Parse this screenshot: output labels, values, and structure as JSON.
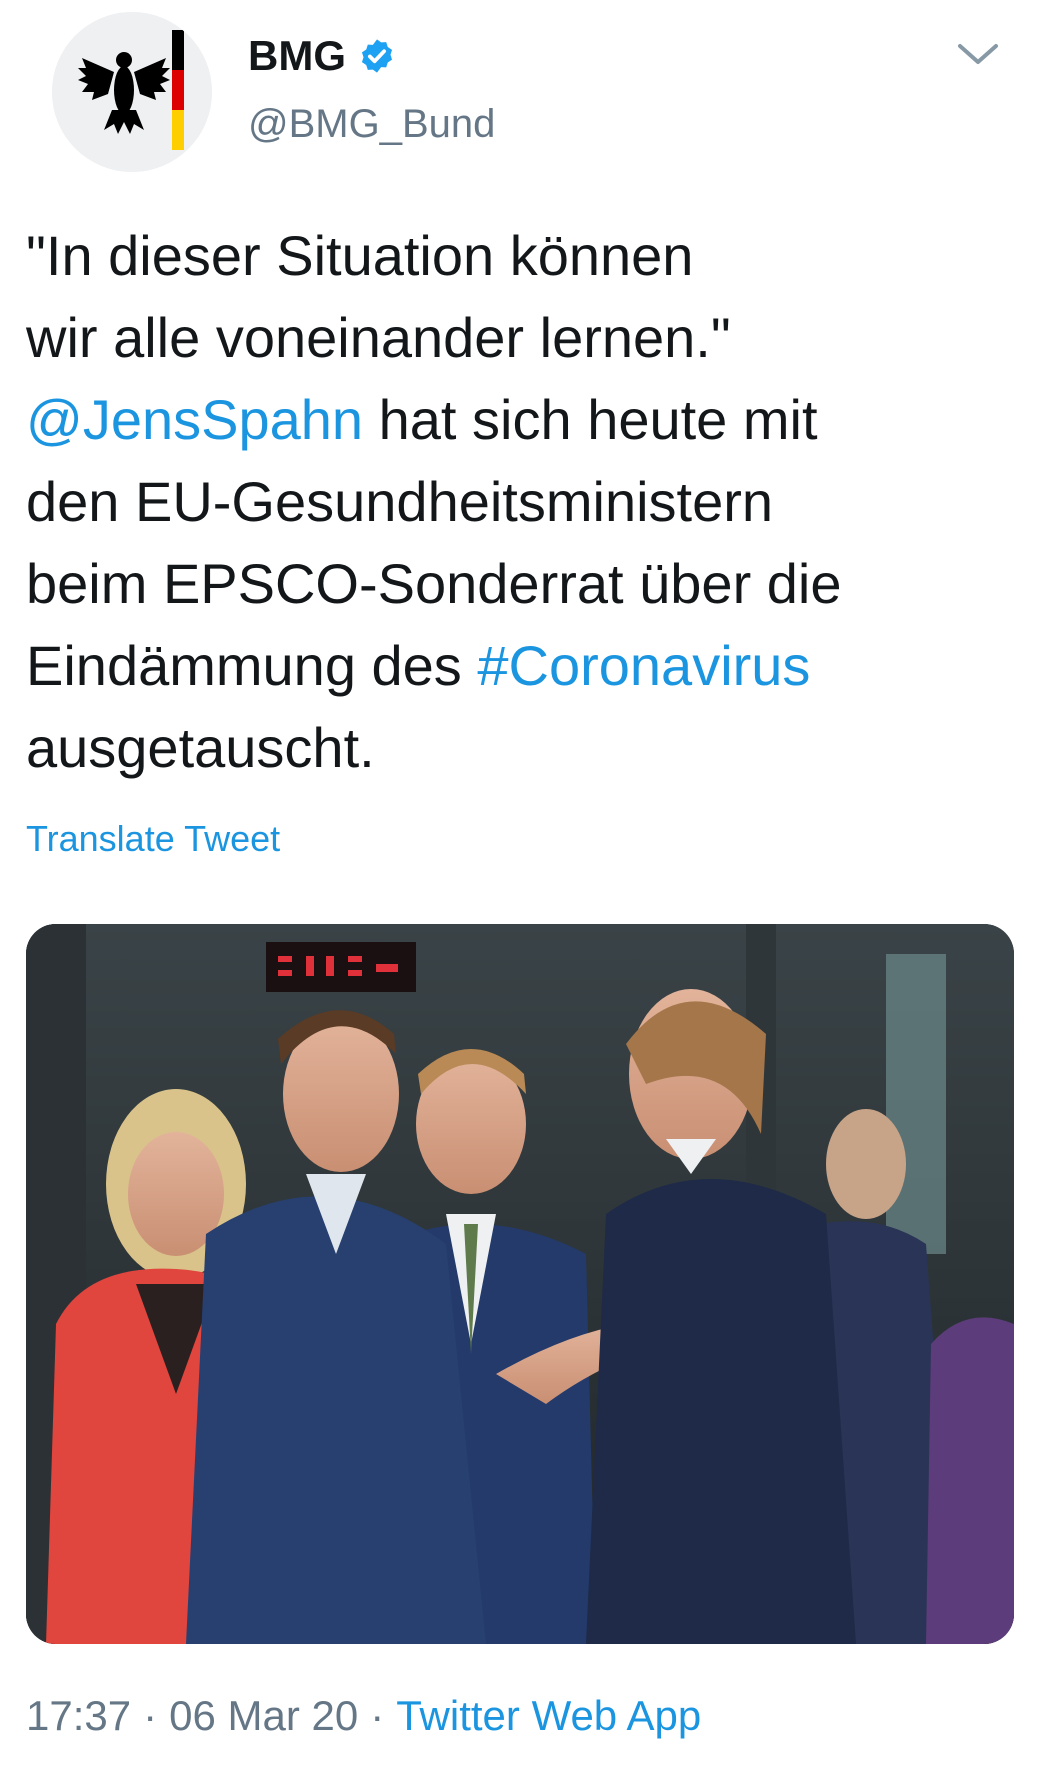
{
  "author": {
    "display_name": "BMG",
    "handle": "@BMG_Bund",
    "verified": true
  },
  "tweet": {
    "text_line1": "\"In dieser Situation können",
    "text_line2": "wir alle voneinander lernen.\"",
    "mention": "@JensSpahn",
    "text_after_mention": " hat sich heute mit",
    "text_line4": "den EU-Gesundheitsministern",
    "text_line5": "beim EPSCO-Sonderrat über die",
    "text_line6_start": "Eindämmung des ",
    "hashtag": "#Coronavirus",
    "text_line7": "ausgetauscht.",
    "translate_label": "Translate Tweet"
  },
  "meta": {
    "time": "17:37",
    "separator": "·",
    "date": "06 Mar 20",
    "source": "Twitter Web App"
  },
  "icons": {
    "avatar": "federal-eagle-logo",
    "verified": "verified-badge-icon",
    "more": "chevron-down-icon"
  },
  "colors": {
    "link": "#1b95e0",
    "secondary": "#657786",
    "text": "#14171a"
  }
}
